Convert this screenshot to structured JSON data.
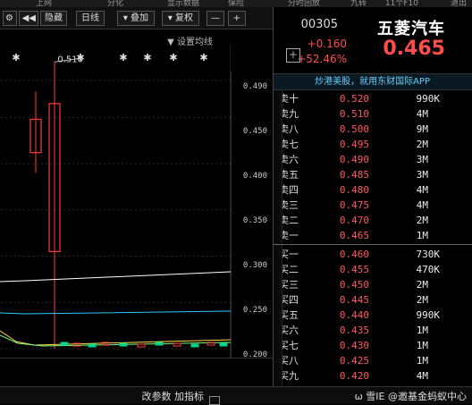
{
  "tabs": [
    "退出",
    "11个F10",
    "九转",
    "分时回放",
    "保险",
    "显示数据",
    "分化",
    "上网"
  ],
  "quote": {
    "name": "五菱汽车",
    "code": "00305",
    "price": "0.465",
    "change": "+0.160",
    "pct": "+52.46%"
  },
  "promo": "炒港美股，就用东财国际APP",
  "order_book": {
    "asks": [
      {
        "label": "卖十",
        "price": "0.520",
        "vol": "990K"
      },
      {
        "label": "卖九",
        "price": "0.510",
        "vol": "4M"
      },
      {
        "label": "卖八",
        "price": "0.500",
        "vol": "9M"
      },
      {
        "label": "卖七",
        "price": "0.495",
        "vol": "2M"
      },
      {
        "label": "卖六",
        "price": "0.490",
        "vol": "3M"
      },
      {
        "label": "卖五",
        "price": "0.485",
        "vol": "3M"
      },
      {
        "label": "卖四",
        "price": "0.480",
        "vol": "4M"
      },
      {
        "label": "卖三",
        "price": "0.475",
        "vol": "4M"
      },
      {
        "label": "卖二",
        "price": "0.470",
        "vol": "2M"
      },
      {
        "label": "卖一",
        "price": "0.465",
        "vol": "1M"
      }
    ],
    "bids": [
      {
        "label": "买一",
        "price": "0.460",
        "vol": "730K"
      },
      {
        "label": "买二",
        "price": "0.455",
        "vol": "470K"
      },
      {
        "label": "买三",
        "price": "0.450",
        "vol": "2M"
      },
      {
        "label": "买四",
        "price": "0.445",
        "vol": "2M"
      },
      {
        "label": "买五",
        "price": "0.440",
        "vol": "990K"
      },
      {
        "label": "买六",
        "price": "0.435",
        "vol": "1M"
      },
      {
        "label": "买七",
        "price": "0.430",
        "vol": "1M"
      },
      {
        "label": "买八",
        "price": "0.425",
        "vol": "1M"
      },
      {
        "label": "买九",
        "price": "0.420",
        "vol": "4M"
      }
    ]
  },
  "bottom_bar": {
    "left_text": "ω 雪IE @邀基金蚂蚁中心",
    "right_text": "改参数 加指标"
  },
  "toolbar": {
    "settings_icon": "gear-icon",
    "prev_label": "◀◀",
    "hide_label": "隐藏",
    "interval_label": "日线",
    "overlay_label": "叠加",
    "adjust_label": "复权",
    "minus_label": "—",
    "plus_label": "+"
  },
  "chart_title": "▼ 设置均线",
  "chart_data": {
    "type": "candlestick",
    "ylabels": [
      "0.490",
      "0.450",
      "0.400",
      "0.350",
      "0.300",
      "0.250",
      "0.200"
    ],
    "ylim": [
      0.2,
      0.49
    ],
    "annotation": "0.510",
    "candles": [
      {
        "open": 0.412,
        "close": 0.448,
        "high": 0.478,
        "low": 0.39,
        "color": "red"
      },
      {
        "open": 0.305,
        "close": 0.465,
        "high": 0.51,
        "low": 0.2,
        "color": "red"
      }
    ],
    "markers": [
      "✱",
      "✱",
      "✱",
      "✱",
      "✱",
      "✱"
    ],
    "colors": {
      "up": "#ff3b3b",
      "down": "#00d28a",
      "ma1": "#ffffff",
      "ma2": "#35c6ff",
      "ma3": "#ffd84a",
      "ma4": "#7cff7c"
    }
  }
}
